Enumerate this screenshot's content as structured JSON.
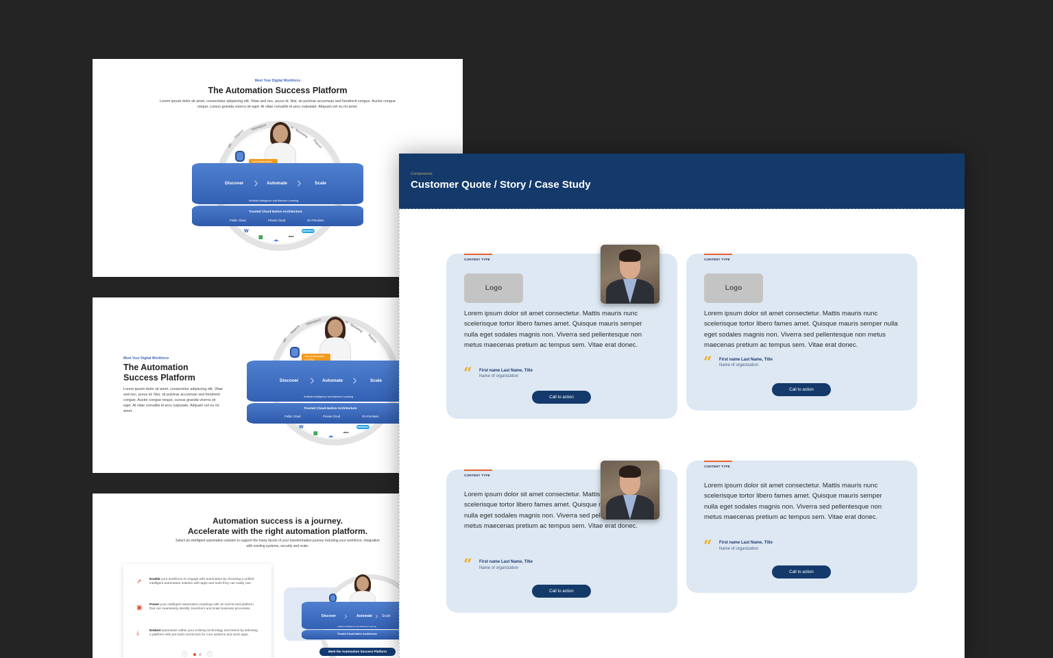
{
  "panel1": {
    "eyebrow": "Meet Your Digital Workforce",
    "title": "The Automation Success Platform",
    "body": "Lorem ipsum dolor sit amet, consectetur adipiscing elit. Vitae sed nec, purus id. Nisi, sit pulvinar accumsan sed hendrerit congue. Auctor congue neque, cursus gravida viverra sit eget. At vitae convallis id arcu vulputate. Aliquam vel eu mi amet."
  },
  "panel2": {
    "eyebrow": "Meet Your Digital Workforce",
    "title": "The Automation Success Platform",
    "body": "Lorem ipsum dolor sit amet, consectetur adipiscing elit. Vitae sed nec, purus id. Nisi, sit pulvinar accumsan sed hendrerit congue. Auctor congue neque, cursus gravida viverra sit eget. At vitae convallis id arcu vulputate. Aliquam vel eu mi amet."
  },
  "graphic": {
    "ring_labels": [
      "HR",
      "Finance",
      "Operations",
      "IT",
      "Marketing",
      "Support"
    ],
    "copilot": "Your Automation Co-Pilot",
    "steps": [
      "Discover",
      "Automate",
      "Scale"
    ],
    "ai_line": "Artificial Intelligence and Machine Learning",
    "arch_title": "Trusted Cloud-Native Architecture",
    "arch_items": [
      "Public Cloud",
      "Private Cloud",
      "On-Premises"
    ],
    "logos": [
      "W",
      "▦",
      "☁",
      "aws",
      "salesforce"
    ]
  },
  "panel3": {
    "title_line1": "Automation success is a journey.",
    "title_line2": "Accelerate with the right automation platform.",
    "subtitle": "Select an intelligent automation solution to support the many facets of your transformation journey including your workforce, integration with existing systems, security and scale.",
    "rows": [
      {
        "lead": "Enable",
        "text": " your workforce to engage with automation by choosing a unified intelligent automation solution with apps and tools they can easily use."
      },
      {
        "lead": "Power",
        "text": " your intelligent automation roadmap with an end-to-end platform that can seamlessly identify, transform and scale business processes."
      },
      {
        "lead": "Embed",
        "text": " automation within your existing technology and teams by selecting a platform with pre-built connectors for core systems and work apps."
      }
    ],
    "pager_prev": "‹",
    "pager_next": "›",
    "button": "Meet the Automation Success Platform"
  },
  "main": {
    "eyebrow": "Components",
    "title": "Customer Quote / Story / Case Study",
    "cards": [
      {
        "content_type": "CONTENT TYPE",
        "logo": "Logo",
        "quote": "Lorem ipsum dolor sit amet consectetur. Mattis mauris nunc scelerisque tortor libero fames amet. Quisque mauris semper nulla eget sodales magnis non. Viverra sed pellentesque non metus maecenas pretium ac tempus sem. Vitae erat donec.",
        "name": "First name Last Name, Title",
        "org": "Name of organization",
        "cta": "Call to action"
      },
      {
        "content_type": "CONTENT TYPE",
        "logo": "Logo",
        "quote": "Lorem ipsum dolor sit amet consectetur. Mattis mauris nunc scelerisque tortor libero fames amet. Quisque mauris semper nulla eget sodales magnis non. Viverra sed pellentesque non metus maecenas pretium ac tempus sem. Vitae erat donec.",
        "name": "First name Last Name, Title",
        "org": "Name of organization",
        "cta": "Call to action"
      },
      {
        "content_type": "CONTENT TYPE",
        "quote": "Lorem ipsum dolor sit amet consectetur. Mattis mauris nunc scelerisque tortor libero fames amet. Quisque mauris semper nulla eget sodales magnis non. Viverra sed pellentesque non metus maecenas pretium ac tempus sem. Vitae erat donec.",
        "name": "First name Last Name, Title",
        "org": "Name of organization",
        "cta": "Call to action"
      },
      {
        "content_type": "CONTENT TYPE",
        "quote": "Lorem ipsum dolor sit amet consectetur. Mattis mauris nunc scelerisque tortor libero fames amet. Quisque mauris semper nulla eget sodales magnis non. Viverra sed pellentesque non metus maecenas pretium ac tempus sem. Vitae erat donec.",
        "name": "First name Last Name, Title",
        "org": "Name of organization",
        "cta": "Call to action"
      }
    ]
  },
  "colors": {
    "background": "#242424",
    "navy": "#143a6b",
    "card": "#dde8f3",
    "accent_orange": "#e8612c",
    "quote_yellow": "#f2a81c",
    "platform_blue": "#3f6fc2"
  }
}
